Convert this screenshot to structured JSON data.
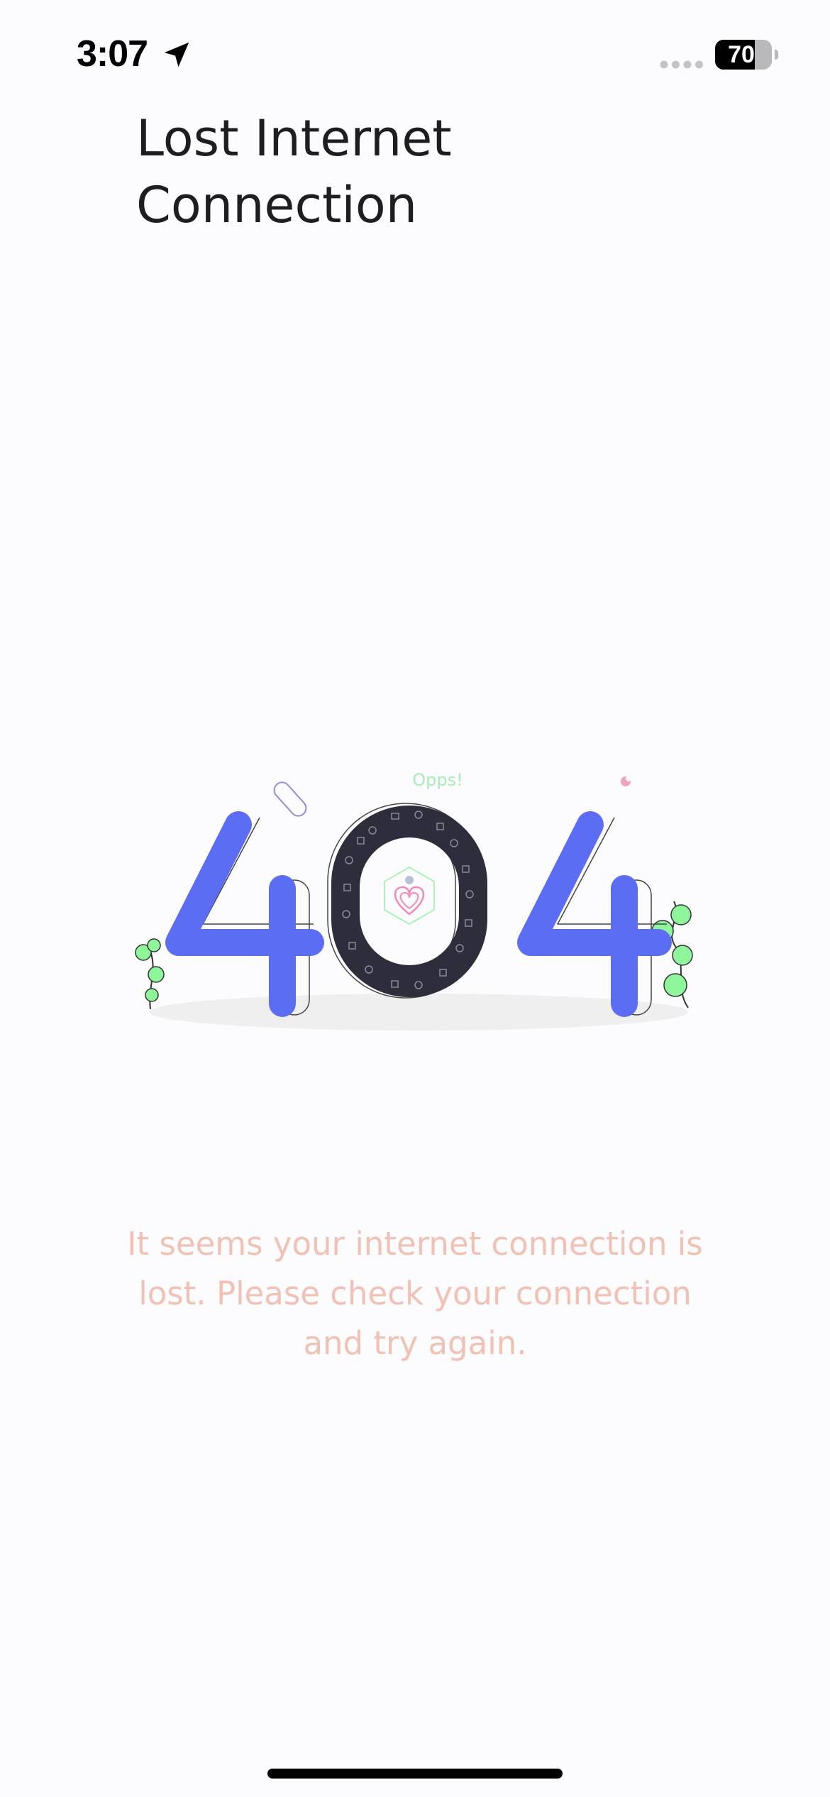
{
  "status_bar": {
    "time": "3:07",
    "battery_level": "70",
    "battery_fraction": 0.7,
    "icons": [
      "location-arrow-icon",
      "signal-icon",
      "battery-icon"
    ]
  },
  "page": {
    "title": "Lost Internet Connection",
    "illustration_text": "Opps!",
    "illustration_digits": "404",
    "message": "It seems your internet connection is lost. Please check your connection and try again."
  },
  "colors": {
    "background": "#fcfbfe",
    "title": "#1e1e22",
    "message": "#f1c1b3",
    "digit_four": "#5b6ef3",
    "digit_zero": "#2d2d3c",
    "leaf": "#8ef59a",
    "shadow": "#efefef"
  }
}
